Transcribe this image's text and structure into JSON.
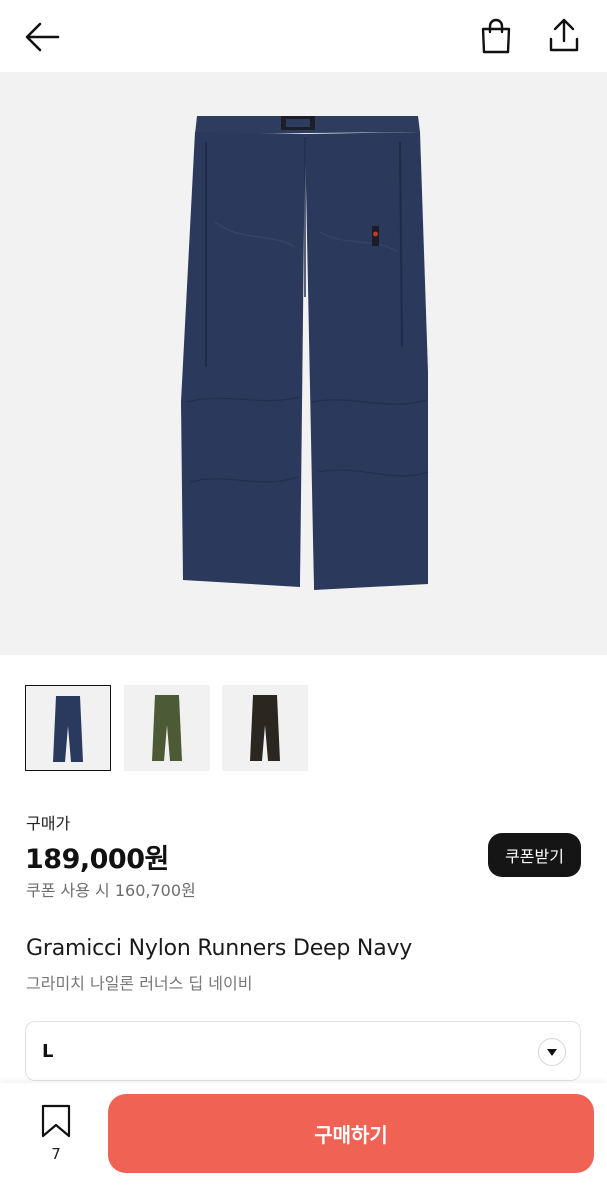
{
  "header": {
    "back_icon": "arrow-left-icon",
    "bag_icon": "shopping-bag-icon",
    "share_icon": "share-upload-icon"
  },
  "gallery": {
    "thumbnails": [
      {
        "color": "#2a3a5e",
        "selected": true
      },
      {
        "color": "#4c5a35",
        "selected": false
      },
      {
        "color": "#2c2620",
        "selected": false
      }
    ]
  },
  "price_section": {
    "label": "구매가",
    "price": "189,000원",
    "coupon_price_text": "쿠폰 사용 시 160,700원",
    "coupon_button": "쿠폰받기"
  },
  "product": {
    "name_en": "Gramicci Nylon Runners Deep Navy",
    "name_ko": "그라미치 나일론 러너스 딥 네이비"
  },
  "size_select": {
    "value": "L"
  },
  "bottom_bar": {
    "wish_count": "7",
    "buy_label": "구매하기",
    "buy_color": "#ef6254"
  }
}
